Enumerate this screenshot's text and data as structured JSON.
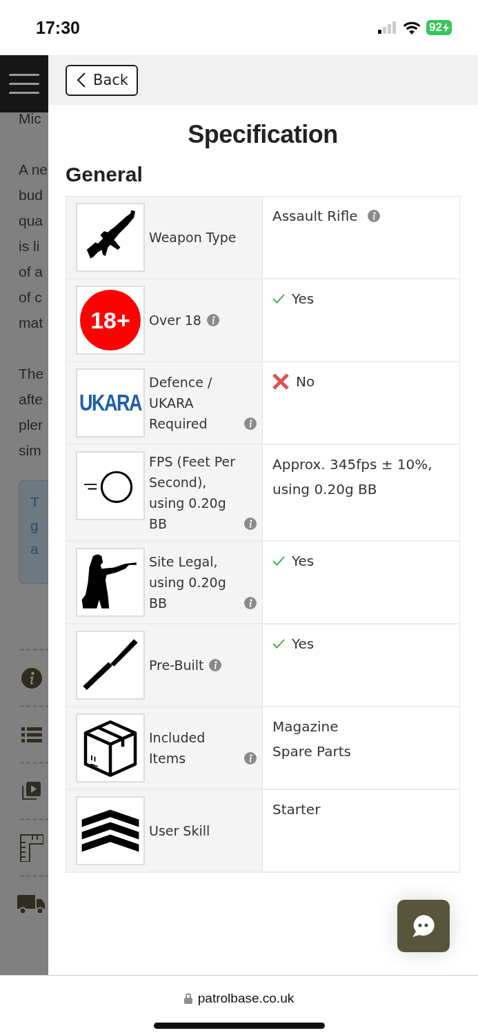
{
  "status_bar": {
    "time": "17:30",
    "battery": "92"
  },
  "background_page": {
    "paragraphs": [
      [
        "Mic"
      ],
      [
        "A ne",
        "bud",
        "qua",
        "is li",
        "of a",
        "of c",
        "mat"
      ],
      [
        "The",
        "afte",
        "pler",
        "sim"
      ]
    ],
    "note_lines": [
      "T",
      "g",
      "a"
    ],
    "side_icons": [
      {
        "kind": "info"
      },
      {
        "kind": "list"
      },
      {
        "kind": "video"
      },
      {
        "kind": "ruler"
      },
      {
        "kind": "truck"
      }
    ]
  },
  "panel": {
    "back_button": "Back",
    "title": "Specification",
    "section": "General",
    "rows": [
      {
        "kind": "rifle",
        "label": "Weapon Type",
        "info": false,
        "value": [
          "Assault Rifle"
        ],
        "value_info": true
      },
      {
        "kind": "age",
        "badge": "18+",
        "label": "Over 18",
        "info": true,
        "check": true,
        "value": [
          "Yes"
        ],
        "value_info": false
      },
      {
        "kind": "ukara",
        "badge": "UKARA",
        "label": "Defence / UKARA Required",
        "info": true,
        "check": false,
        "value": [
          "No"
        ],
        "value_info": false
      },
      {
        "kind": "bb",
        "label": "FPS (Feet Per Second), using 0.20g BB",
        "info": true,
        "value": [
          "Approx. 345fps ± 10%, using 0.20g BB"
        ],
        "value_info": false
      },
      {
        "kind": "shooter",
        "label": "Site Legal, using 0.20g BB",
        "info": true,
        "check": true,
        "value": [
          "Yes"
        ],
        "value_info": false
      },
      {
        "kind": "screwdriver",
        "label": "Pre-Built",
        "info": true,
        "check": true,
        "value": [
          "Yes"
        ],
        "value_info": false
      },
      {
        "kind": "box",
        "label": "Included Items",
        "info": true,
        "value": [
          "Magazine",
          "Spare Parts"
        ],
        "value_info": false
      },
      {
        "kind": "chevrons",
        "label": "User Skill",
        "info": false,
        "value": [
          "Starter"
        ],
        "value_info": false
      }
    ]
  },
  "url_bar": {
    "url": "patrolbase.co.uk"
  }
}
